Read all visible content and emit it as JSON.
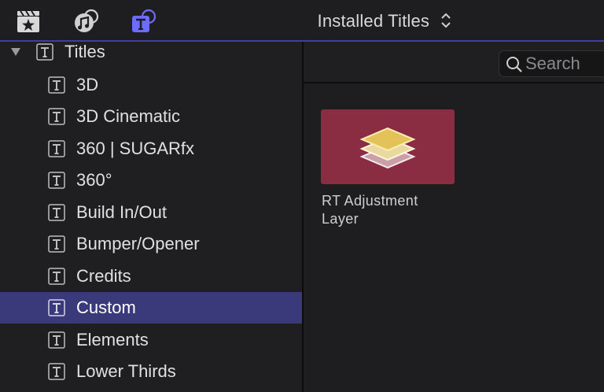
{
  "toolbar": {
    "library_title": "Installed Titles",
    "icons": [
      "media-browser-icon",
      "audio-browser-icon",
      "titles-browser-icon"
    ],
    "accent_color": "#6c6cff"
  },
  "sidebar": {
    "root": {
      "label": "Titles"
    },
    "items": [
      {
        "label": "3D"
      },
      {
        "label": "3D Cinematic"
      },
      {
        "label": "360 | SUGARfx"
      },
      {
        "label": "360°"
      },
      {
        "label": "Build In/Out"
      },
      {
        "label": "Bumper/Opener"
      },
      {
        "label": "Credits"
      },
      {
        "label": "Custom",
        "selected": true
      },
      {
        "label": "Elements"
      },
      {
        "label": "Lower Thirds"
      }
    ],
    "selection_color": "#3a3a7a"
  },
  "search": {
    "placeholder": "Search"
  },
  "content": {
    "tiles": [
      {
        "caption": "RT Adjustment Layer",
        "color": "#8a2c42",
        "icon": "layers-stack-icon"
      }
    ]
  }
}
